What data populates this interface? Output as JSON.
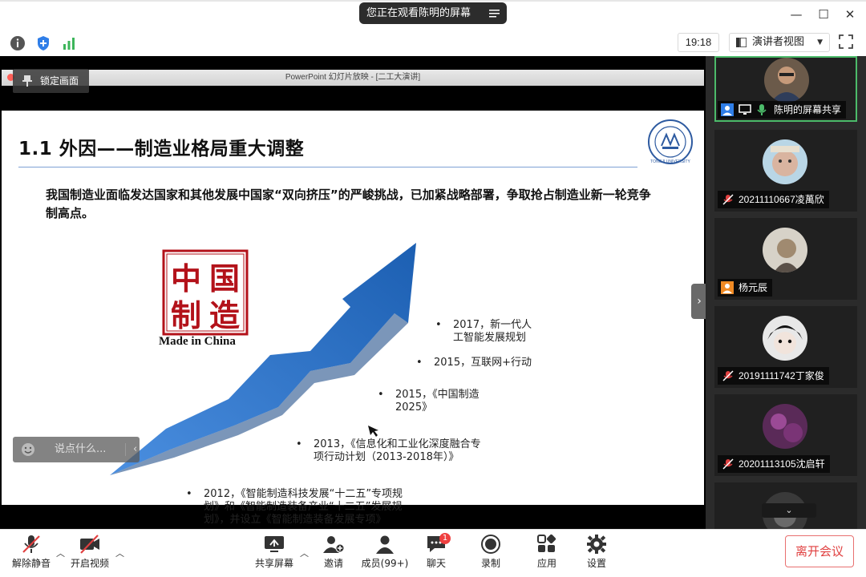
{
  "window": {
    "viewing_banner": "您正在观看陈明的屏幕"
  },
  "toolbar": {
    "time": "19:18",
    "view_mode": "演讲者视图"
  },
  "presentation": {
    "window_title": "PowerPoint 幻灯片放映 - [二工大演讲]",
    "lock_label": "锁定画面",
    "slide": {
      "title": "1.1 外因——制造业格局重大调整",
      "intro": "我国制造业面临发达国家和其他发展中国家“双向挤压”的严峻挑战，已加紧战略部署，争取抢占制造业新一轮竞争制高点。",
      "stamp_text": [
        "中",
        "国",
        "制",
        "造"
      ],
      "stamp_caption": "Made in China",
      "seal_text": "TONGJI UNIVERSITY",
      "milestones": [
        {
          "line1": "2017，新一代人",
          "line2": "工智能发展规划"
        },
        {
          "line1": "2015，互联网+行动",
          "line2": ""
        },
        {
          "line1": "2015，《中国制造",
          "line2": "2025》"
        },
        {
          "line1": "2013，《信息化和工业化深度融合专",
          "line2": "项行动计划（2013-2018年）》"
        },
        {
          "line1": "2012，《智能制造科技发展“十二五”专项规",
          "line2": "划》和《智能制造装备产业“十二五”发展规",
          "line3": "划》，并设立《智能制造装备发展专项》"
        }
      ]
    },
    "chat_placeholder": "说点什么..."
  },
  "participants": [
    {
      "name": "陈明的屏幕共享",
      "active": true
    },
    {
      "name": "20211110667凌萬欣",
      "active": false
    },
    {
      "name": "杨元辰",
      "active": false
    },
    {
      "name": "20191111742丁家俊",
      "active": false
    },
    {
      "name": "20201113105沈启轩",
      "active": false
    }
  ],
  "bottom_bar": {
    "mute": "解除静音",
    "video": "开启视频",
    "share": "共享屏幕",
    "invite": "邀请",
    "members": "成员(99+)",
    "chat": "聊天",
    "chat_badge": "1",
    "record": "录制",
    "apps": "应用",
    "settings": "设置",
    "leave": "离开会议"
  },
  "colors": {
    "accent_green": "#4cbb6a",
    "arrow_blue": "#2b72c4",
    "leave_red": "#e04040",
    "stamp_red": "#b3121a"
  }
}
